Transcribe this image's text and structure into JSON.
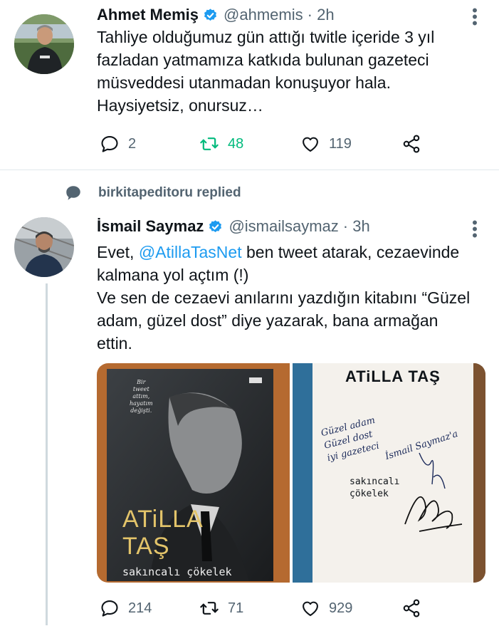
{
  "tweet1": {
    "name": "Ahmet Memiş",
    "handle": "@ahmemis",
    "time": "· 2h",
    "text": "Tahliye olduğumuz gün attığı twitle içeride 3 yıl\nfazladan yatmamıza katkıda bulunan gazeteci\nmüsveddesi utanmadan konuşuyor hala.\nHaysiyetsiz, onursuz…",
    "replies": "2",
    "retweets": "48",
    "likes": "119"
  },
  "replied_label": "birkitapeditoru replied",
  "tweet2": {
    "name": "İsmail Saymaz",
    "handle": "@ismailsaymaz",
    "time": "· 3h",
    "text_prefix": "Evet, ",
    "mention": "@AtillaTasNet",
    "text_rest": " ben tweet atarak, cezaevinde\nkalmana yol açtım (!)\nVe sen de cezaevi anılarını yazdığın kitabını “Güzel\nadam, güzel dost” diye yazarak, bana armağan\nettin.",
    "replies": "214",
    "retweets": "71",
    "likes": "929"
  },
  "book_cover": {
    "quote_l1": "Bir",
    "quote_l2": "tweet",
    "quote_l3": "attım,",
    "quote_l4": "hayatım",
    "quote_l5": "değişti.",
    "author_l1": "ATiLLA",
    "author_l2": "TAŞ",
    "subtitle": "sakıncalı çökelek"
  },
  "book_page": {
    "title": "ATiLLA TAŞ",
    "hand_l1": "Güzel adam",
    "hand_l2": "Güzel dost",
    "hand_l3": "iyi gazeteci",
    "hand_l4": "İsmail Saymaz'a",
    "subtitle_l1": "sakıncalı",
    "subtitle_l2": "çökelek"
  },
  "colors": {
    "accent": "#1d9bf0",
    "retweet_active": "#00ba7c",
    "muted": "#536471"
  }
}
